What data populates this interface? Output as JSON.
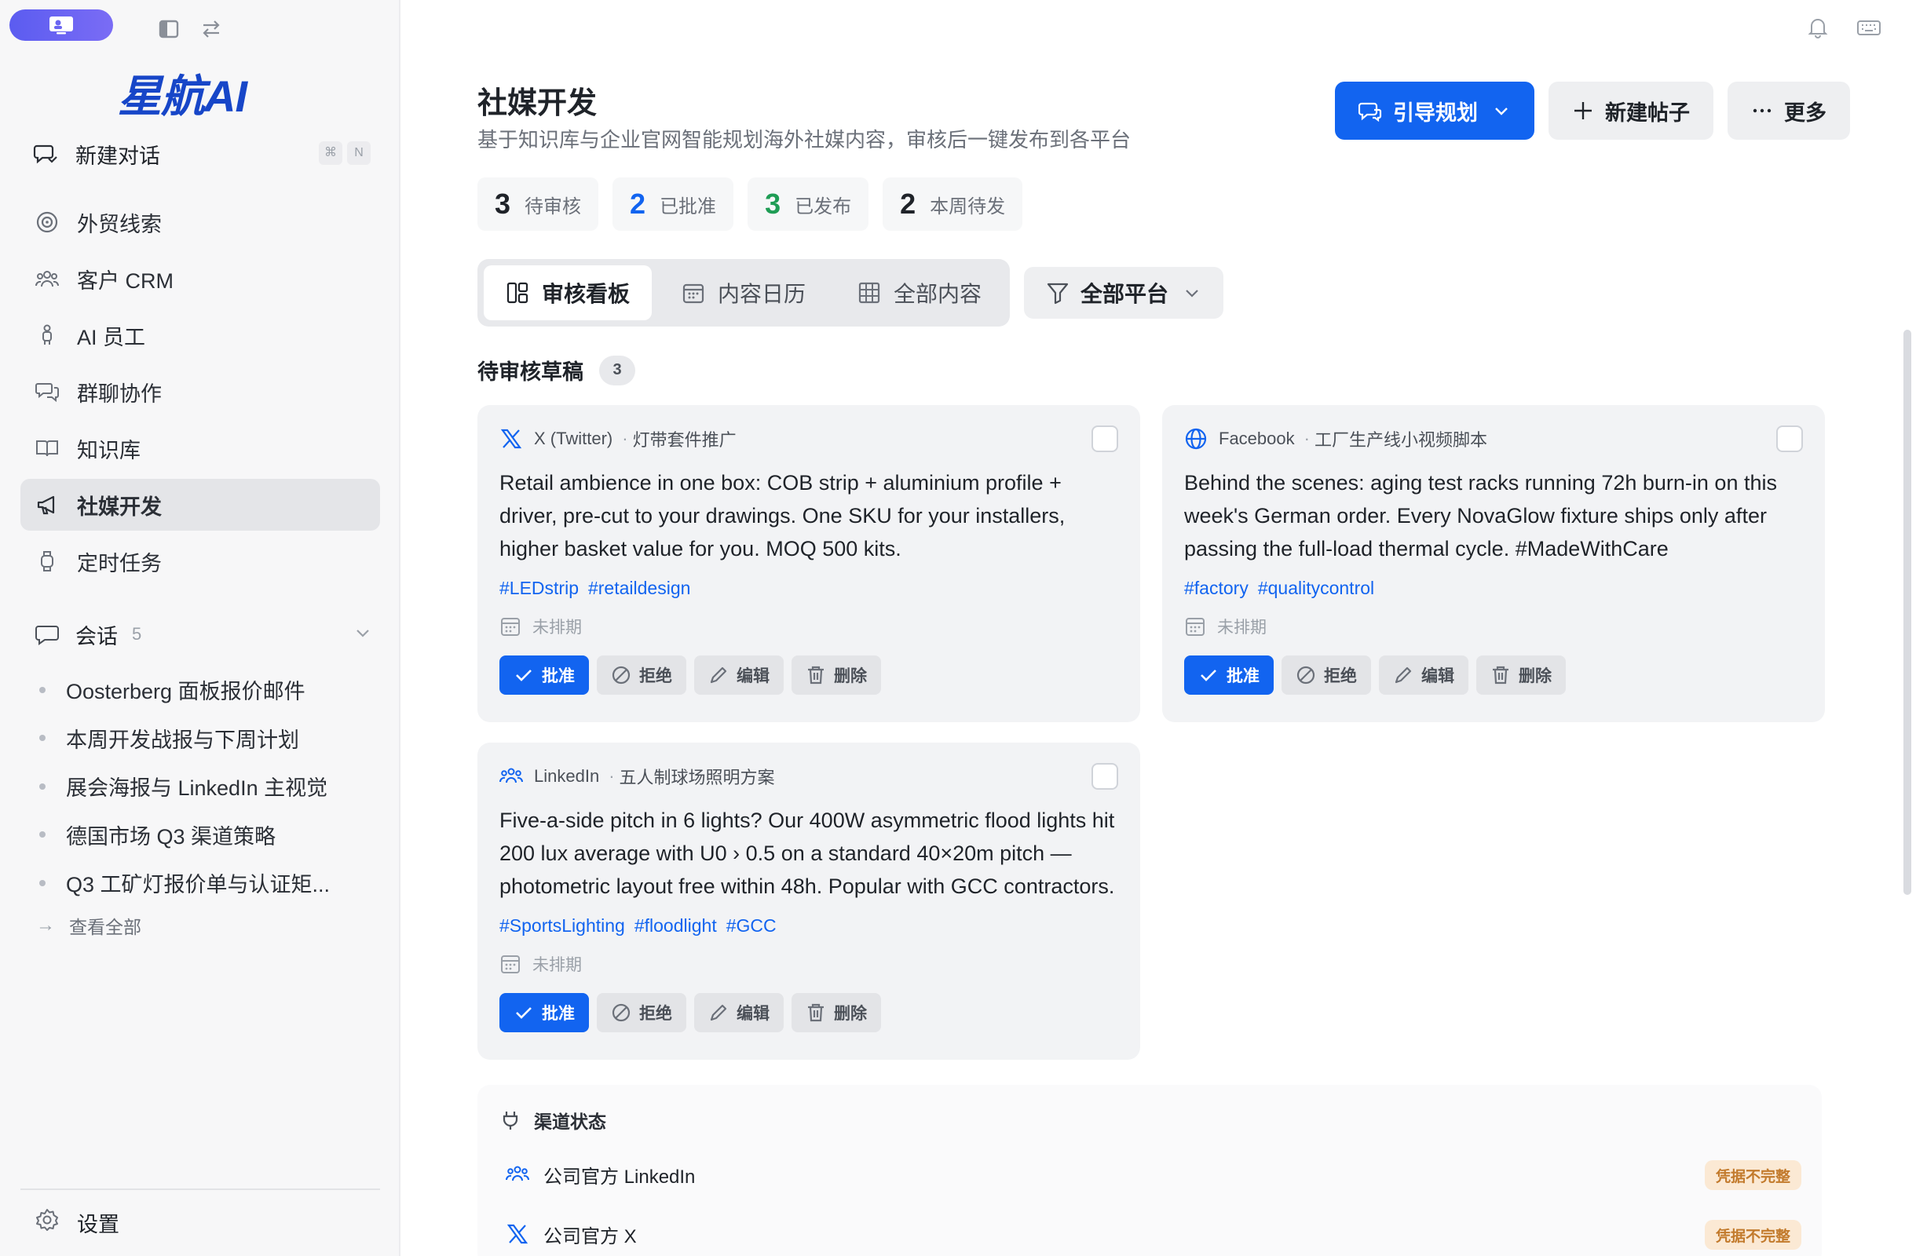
{
  "sidebar": {
    "logo": "星航AI",
    "new_chat": {
      "label": "新建对话",
      "shortcut": [
        "⌘",
        "N"
      ]
    },
    "nav": [
      {
        "label": "外贸线索",
        "icon": "target-icon"
      },
      {
        "label": "客户 CRM",
        "icon": "users-icon"
      },
      {
        "label": "AI 员工",
        "icon": "agent-icon"
      },
      {
        "label": "群聊协作",
        "icon": "chat-group-icon"
      },
      {
        "label": "知识库",
        "icon": "book-icon"
      },
      {
        "label": "社媒开发",
        "icon": "megaphone-icon",
        "active": true
      },
      {
        "label": "定时任务",
        "icon": "watch-icon"
      }
    ],
    "sessions": {
      "label": "会话",
      "count": "5",
      "items": [
        "Oosterberg 面板报价邮件",
        "本周开发战报与下周计划",
        "展会海报与 LinkedIn 主视觉",
        "德国市场 Q3 渠道策略",
        "Q3 工矿灯报价单与认证矩..."
      ],
      "view_all": "查看全部"
    },
    "settings": "设置"
  },
  "header": {
    "title": "社媒开发",
    "subtitle": "基于知识库与企业官网智能规划海外社媒内容，审核后一键发布到各平台",
    "buttons": {
      "plan": "引导规划",
      "new_post": "新建帖子",
      "more": "更多"
    }
  },
  "stats": [
    {
      "num": "3",
      "label": "待审核",
      "color": "#1f2329"
    },
    {
      "num": "2",
      "label": "已批准",
      "color": "#1264f0"
    },
    {
      "num": "3",
      "label": "已发布",
      "color": "#1f9d55"
    },
    {
      "num": "2",
      "label": "本周待发",
      "color": "#1f2329"
    }
  ],
  "tabs": [
    {
      "label": "审核看板",
      "active": true
    },
    {
      "label": "内容日历"
    },
    {
      "label": "全部内容"
    }
  ],
  "filter": {
    "label": "全部平台"
  },
  "section": {
    "label": "待审核草稿",
    "count": "3"
  },
  "cards": [
    {
      "platform": "X (Twitter)",
      "project": "灯带套件推广",
      "body": "Retail ambience in one box: COB strip + aluminium profile + driver, pre-cut to your drawings. One SKU for your installers, higher basket value for you. MOQ 500 kits.",
      "tags": [
        "#LEDstrip",
        "#retaildesign"
      ],
      "schedule": "未排期"
    },
    {
      "platform": "Facebook",
      "project": "工厂生产线小视频脚本",
      "body": "Behind the scenes: aging test racks running 72h burn-in on this week's German order. Every NovaGlow fixture ships only after passing the full-load thermal cycle. #MadeWithCare",
      "tags": [
        "#factory",
        "#qualitycontrol"
      ],
      "schedule": "未排期"
    },
    {
      "platform": "LinkedIn",
      "project": "五人制球场照明方案",
      "body": "Five-a-side pitch in 6 lights? Our 400W asymmetric flood lights hit 200 lux average with U0 › 0.5 on a standard 40×20m pitch — photometric layout free within 48h. Popular with GCC contractors.",
      "tags": [
        "#SportsLighting",
        "#floodlight",
        "#GCC"
      ],
      "schedule": "未排期"
    }
  ],
  "card_actions": {
    "approve": "批准",
    "reject": "拒绝",
    "edit": "编辑",
    "delete": "删除"
  },
  "channels": {
    "title": "渠道状态",
    "rows": [
      {
        "name": "公司官方 LinkedIn",
        "status": "凭据不完整"
      },
      {
        "name": "公司官方 X",
        "status": "凭据不完整"
      }
    ]
  }
}
